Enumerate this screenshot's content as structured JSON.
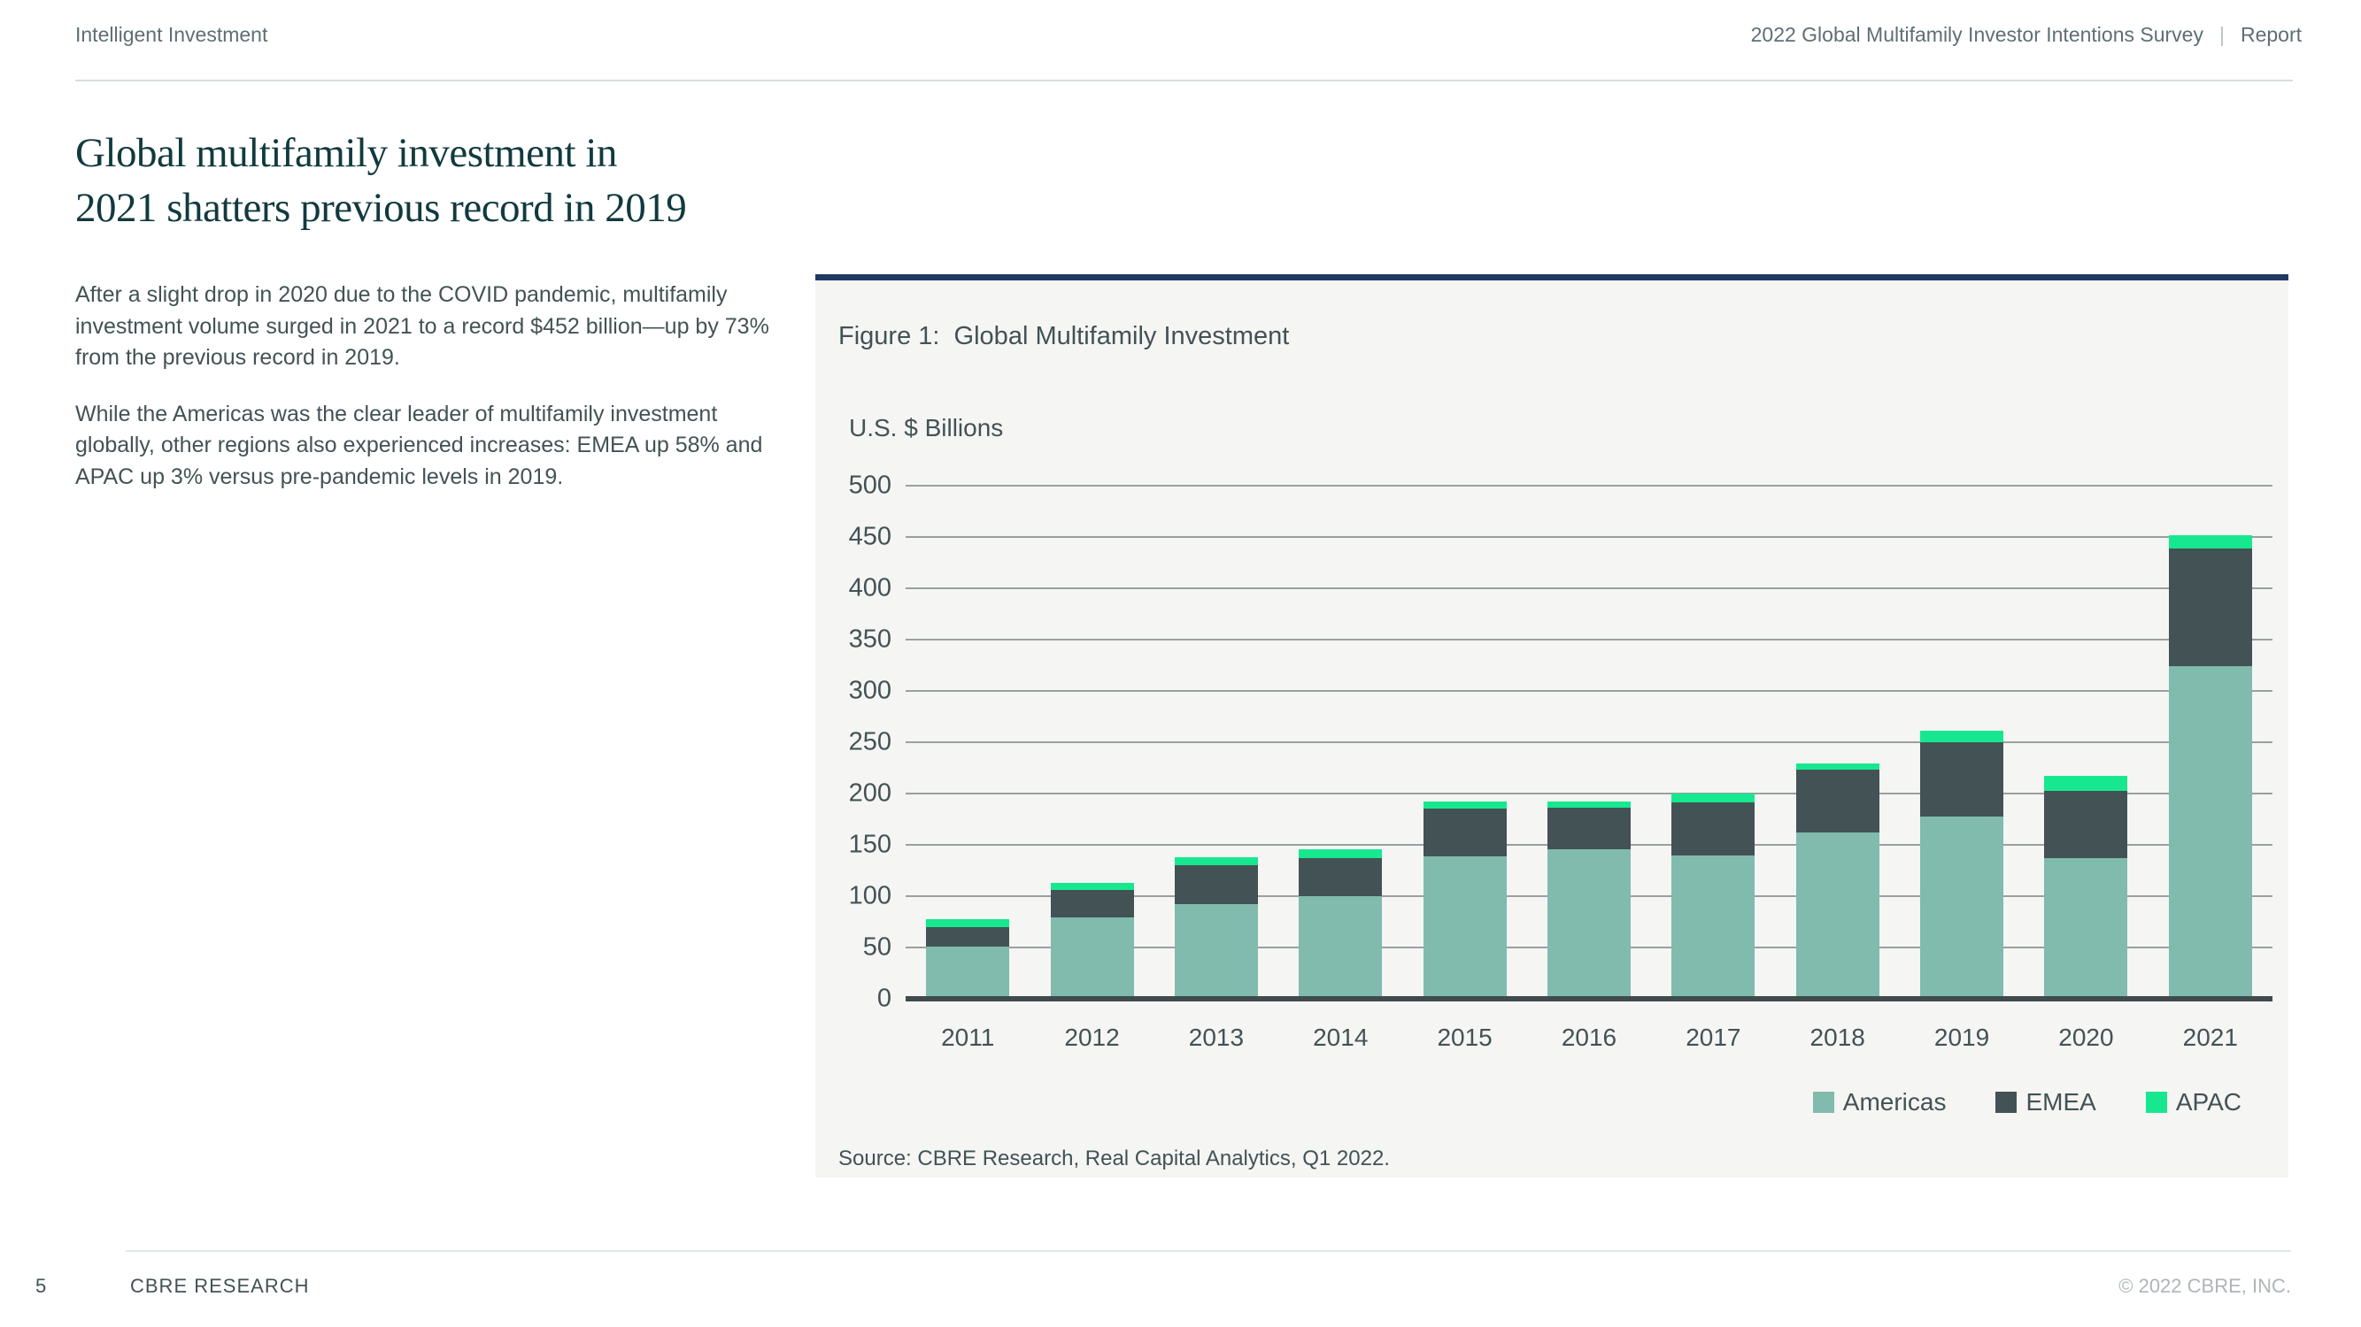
{
  "header": {
    "left": "Intelligent Investment",
    "right_title": "2022 Global Multifamily Investor Intentions Survey",
    "separator": "|",
    "right_tag": "Report"
  },
  "article": {
    "title_line1": "Global multifamily investment in",
    "title_line2": "2021 shatters previous record in 2019",
    "paragraph1": "After a slight drop in 2020 due to the COVID pandemic, multifamily investment volume surged in 2021 to a record $452 billion—up by 73% from the previous record in 2019.",
    "paragraph2": "While the Americas was the clear leader of multifamily investment globally, other regions also experienced increases: EMEA up 58% and APAC up 3% versus pre-pandemic levels in 2019."
  },
  "figure": {
    "title": "Figure 1:  Global Multifamily Investment",
    "axis_title": "U.S. $ Billions",
    "source": "Source: CBRE Research, Real Capital Analytics, Q1 2022."
  },
  "chart_data": {
    "type": "bar",
    "stacked": true,
    "title": "Figure 1: Global Multifamily Investment",
    "ylabel": "U.S. $ Billions",
    "xlabel": "",
    "categories": [
      "2011",
      "2012",
      "2013",
      "2014",
      "2015",
      "2016",
      "2017",
      "2018",
      "2019",
      "2020",
      "2021"
    ],
    "series": [
      {
        "name": "Americas",
        "color": "#80BBAD",
        "values": [
          51,
          79,
          92,
          100,
          139,
          146,
          140,
          162,
          178,
          137,
          324
        ]
      },
      {
        "name": "EMEA",
        "color": "#435254",
        "values": [
          19,
          27,
          38,
          37,
          46,
          40,
          51,
          61,
          72,
          66,
          115
        ]
      },
      {
        "name": "APAC",
        "color": "#17E88F",
        "values": [
          8,
          7,
          8,
          9,
          7,
          6,
          9,
          6,
          11,
          14,
          13
        ]
      }
    ],
    "totals": [
      78,
      113,
      138,
      146,
      192,
      192,
      200,
      229,
      261,
      217,
      452
    ],
    "ylim": [
      0,
      500
    ],
    "ytick_step": 50,
    "grid": true,
    "legend_position": "bottom-right",
    "colors": {
      "accent_navy": "#203a63",
      "panel_background": "#f5f5f4",
      "gridline": "#9aa09f",
      "axis_line": "#3f4b4d"
    }
  },
  "footer": {
    "page_number": "5",
    "left": "CBRE RESEARCH",
    "right": "© 2022 CBRE, INC."
  }
}
